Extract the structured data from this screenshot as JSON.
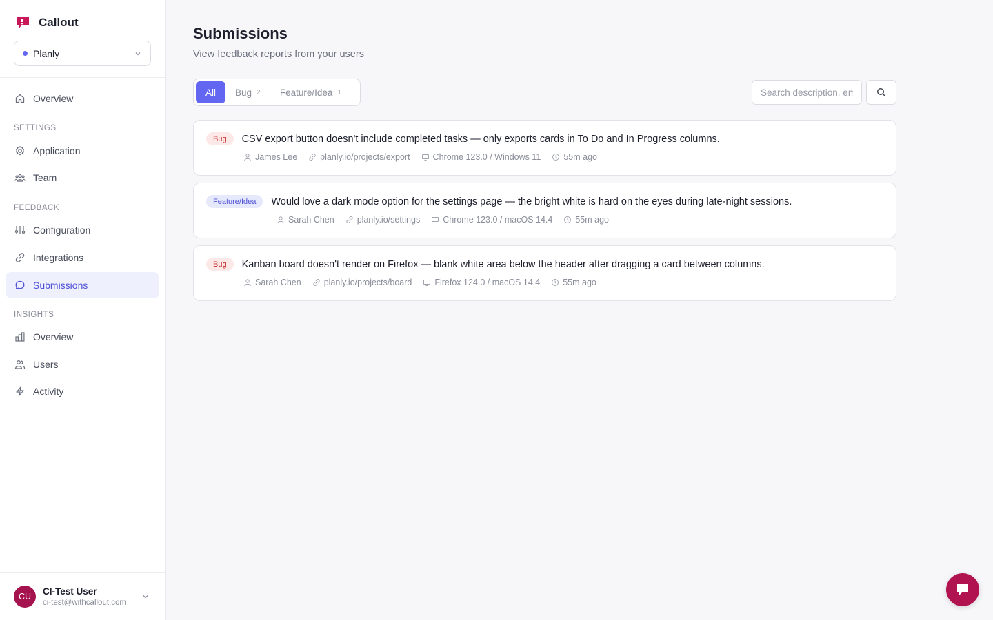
{
  "app": {
    "name": "Callout",
    "accent_color": "#6366f1",
    "brand_color": "#b0134f"
  },
  "project_selector": {
    "selected": "Planly"
  },
  "sidebar": {
    "top_items": [
      {
        "label": "Overview",
        "icon": "home-icon"
      }
    ],
    "sections": [
      {
        "label": "SETTINGS",
        "items": [
          {
            "label": "Application",
            "icon": "gear-icon"
          },
          {
            "label": "Team",
            "icon": "team-icon"
          }
        ]
      },
      {
        "label": "FEEDBACK",
        "items": [
          {
            "label": "Configuration",
            "icon": "sliders-icon"
          },
          {
            "label": "Integrations",
            "icon": "link-icon"
          },
          {
            "label": "Submissions",
            "icon": "chat-icon",
            "active": true
          }
        ]
      },
      {
        "label": "INSIGHTS",
        "items": [
          {
            "label": "Overview",
            "icon": "bar-chart-icon"
          },
          {
            "label": "Users",
            "icon": "users-icon"
          },
          {
            "label": "Activity",
            "icon": "bolt-icon"
          }
        ]
      }
    ]
  },
  "user": {
    "initials": "CU",
    "name": "CI-Test User",
    "email": "ci-test@withcallout.com"
  },
  "page": {
    "title": "Submissions",
    "subtitle": "View feedback reports from your users"
  },
  "tabs": [
    {
      "label": "All",
      "count": null,
      "active": true
    },
    {
      "label": "Bug",
      "count": "2"
    },
    {
      "label": "Feature/Idea",
      "count": "1"
    }
  ],
  "search": {
    "placeholder": "Search description, email..."
  },
  "submissions": [
    {
      "type": "Bug",
      "title": "CSV export button doesn't include completed tasks — only exports cards in To Do and In Progress columns.",
      "user": "James Lee",
      "url": "planly.io/projects/export",
      "browser": "Chrome 123.0 / Windows 11",
      "time": "55m ago"
    },
    {
      "type": "Feature/Idea",
      "title": "Would love a dark mode option for the settings page — the bright white is hard on the eyes during late-night sessions.",
      "user": "Sarah Chen",
      "url": "planly.io/settings",
      "browser": "Chrome 123.0 / macOS 14.4",
      "time": "55m ago"
    },
    {
      "type": "Bug",
      "title": "Kanban board doesn't render on Firefox — blank white area below the header after dragging a card between columns.",
      "user": "Sarah Chen",
      "url": "planly.io/projects/board",
      "browser": "Firefox 124.0 / macOS 14.4",
      "time": "55m ago"
    }
  ]
}
